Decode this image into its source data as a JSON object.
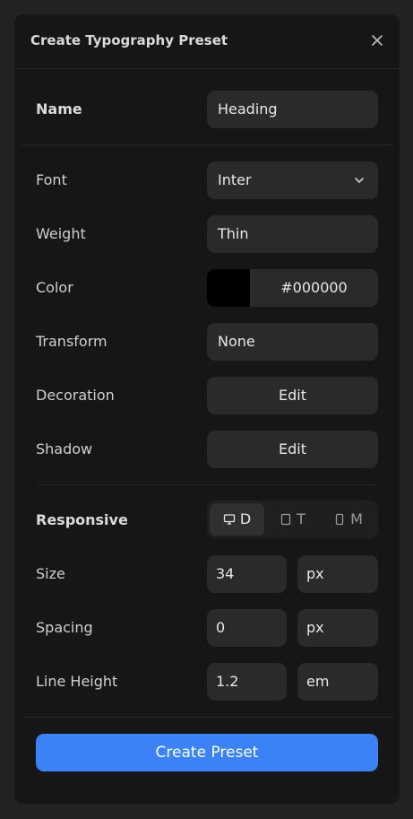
{
  "dialog": {
    "title": "Create Typography Preset"
  },
  "name_row": {
    "label": "Name",
    "value": "Heading"
  },
  "font_row": {
    "label": "Font",
    "value": "Inter"
  },
  "weight_row": {
    "label": "Weight",
    "value": "Thin"
  },
  "color_row": {
    "label": "Color",
    "value": "#000000",
    "swatch": "#000000"
  },
  "transform_row": {
    "label": "Transform",
    "value": "None"
  },
  "decoration_row": {
    "label": "Decoration",
    "button": "Edit"
  },
  "shadow_row": {
    "label": "Shadow",
    "button": "Edit"
  },
  "responsive": {
    "label": "Responsive",
    "options": [
      {
        "label": "D",
        "icon": "desktop-icon",
        "active": true
      },
      {
        "label": "T",
        "icon": "tablet-icon",
        "active": false
      },
      {
        "label": "M",
        "icon": "mobile-icon",
        "active": false
      }
    ]
  },
  "size_row": {
    "label": "Size",
    "value": "34",
    "unit": "px"
  },
  "spacing_row": {
    "label": "Spacing",
    "value": "0",
    "unit": "px"
  },
  "line_height_row": {
    "label": "Line Height",
    "value": "1.2",
    "unit": "em"
  },
  "actions": {
    "primary": "Create Preset"
  },
  "colors": {
    "accent": "#3b82f6",
    "panel": "#161616",
    "field": "#2a2a2a"
  }
}
